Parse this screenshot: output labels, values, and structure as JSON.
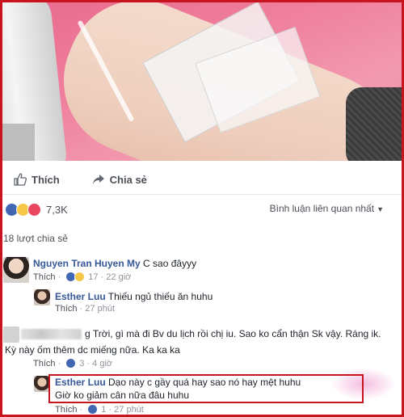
{
  "post": {
    "actions": {
      "like_label": "Thích",
      "share_label": "Chia sẻ"
    },
    "reactions": {
      "count": "7,3K",
      "icons": [
        "like-icon",
        "sad-icon",
        "love-icon"
      ]
    },
    "sort_label": "Bình luận liên quan nhất",
    "shares_label": "18 lượt chia sẻ"
  },
  "comments": [
    {
      "author": "Nguyen Tran Huyen My",
      "text": "C sao đâyyy",
      "like_label": "Thích",
      "reaction_count": "17",
      "time": "22 giờ",
      "replies": [
        {
          "author": "Esther Luu",
          "text": "Thiếu ngủ thiếu ăn huhu",
          "like_label": "Thích",
          "time": "27 phút"
        }
      ]
    },
    {
      "author_prefix": "g",
      "text": "Trời, gì mà đi Bv du lịch rồi chị iu. Sao ko cẩn thận Sk vậy. Ráng ik.",
      "text2": "Kỳ này ốm thêm dc miếng nữa. Ka ka ka",
      "like_label": "Thích",
      "reaction_count": "3",
      "time": "4 giờ",
      "replies": [
        {
          "author": "Esther Luu",
          "text": "Dạo này c gầy quá hay sao nó hay mệt huhu",
          "text2": "Giờ ko giảm cân nữa đâu huhu",
          "like_label": "Thích",
          "reaction_count": "1",
          "time": "27 phút"
        }
      ]
    }
  ],
  "colors": {
    "highlight": "#c8141e",
    "link": "#365899",
    "meta": "#90949c"
  }
}
